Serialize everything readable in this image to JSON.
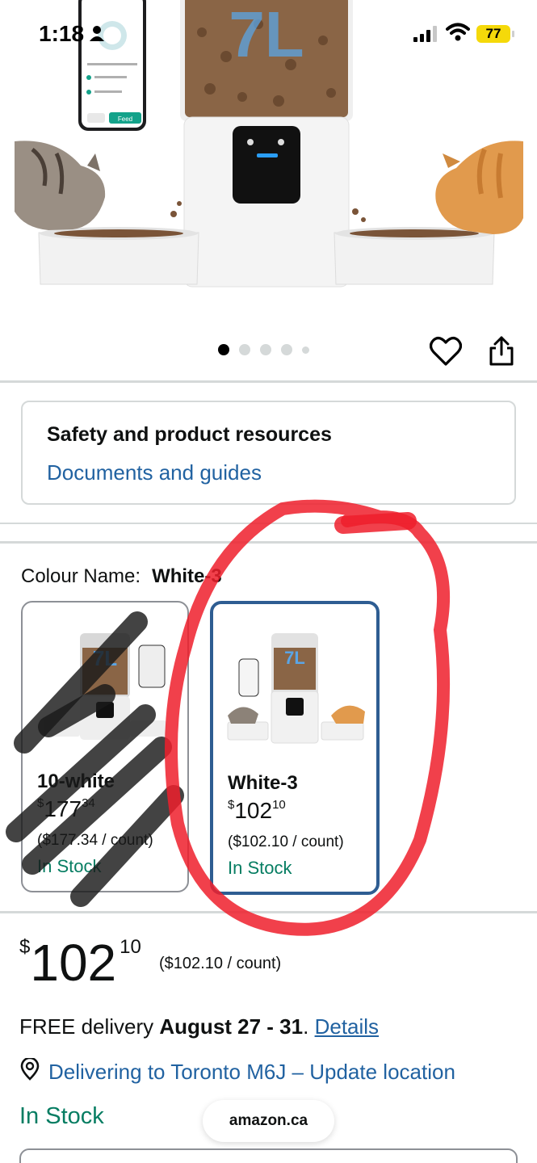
{
  "status_bar": {
    "time": "1:18",
    "battery": "77"
  },
  "product_image": {
    "badge_text": "7L",
    "phone_button": "Feed"
  },
  "carousel": {
    "dot_count": 5,
    "active_index": 0
  },
  "resources": {
    "title": "Safety and product resources",
    "link": "Documents and guides"
  },
  "colour": {
    "label": "Colour Name:",
    "selected": "White-3"
  },
  "variants": [
    {
      "name": "10-white",
      "price_whole": "177",
      "price_fraction": "34",
      "currency": "$",
      "unit_price": "($177.34 / count)",
      "stock": "In Stock",
      "selected": false
    },
    {
      "name": "White-3",
      "price_whole": "102",
      "price_fraction": "10",
      "currency": "$",
      "unit_price": "($102.10 / count)",
      "stock": "In Stock",
      "selected": true
    }
  ],
  "price": {
    "currency": "$",
    "whole": "102",
    "fraction": "10",
    "unit": "($102.10 / count)"
  },
  "delivery": {
    "prefix": "FREE delivery",
    "dates": "August 27 - 31",
    "separator": ".",
    "details_link": "Details"
  },
  "location": {
    "text": "Delivering to Toronto M6J – Update location"
  },
  "stock_status": "In Stock",
  "browser": {
    "url": "amazon.ca"
  },
  "colors": {
    "link": "#2162a1",
    "stock_green": "#067d62",
    "selected_border": "#2e5d92",
    "annotation_red": "#ee1f2b"
  }
}
